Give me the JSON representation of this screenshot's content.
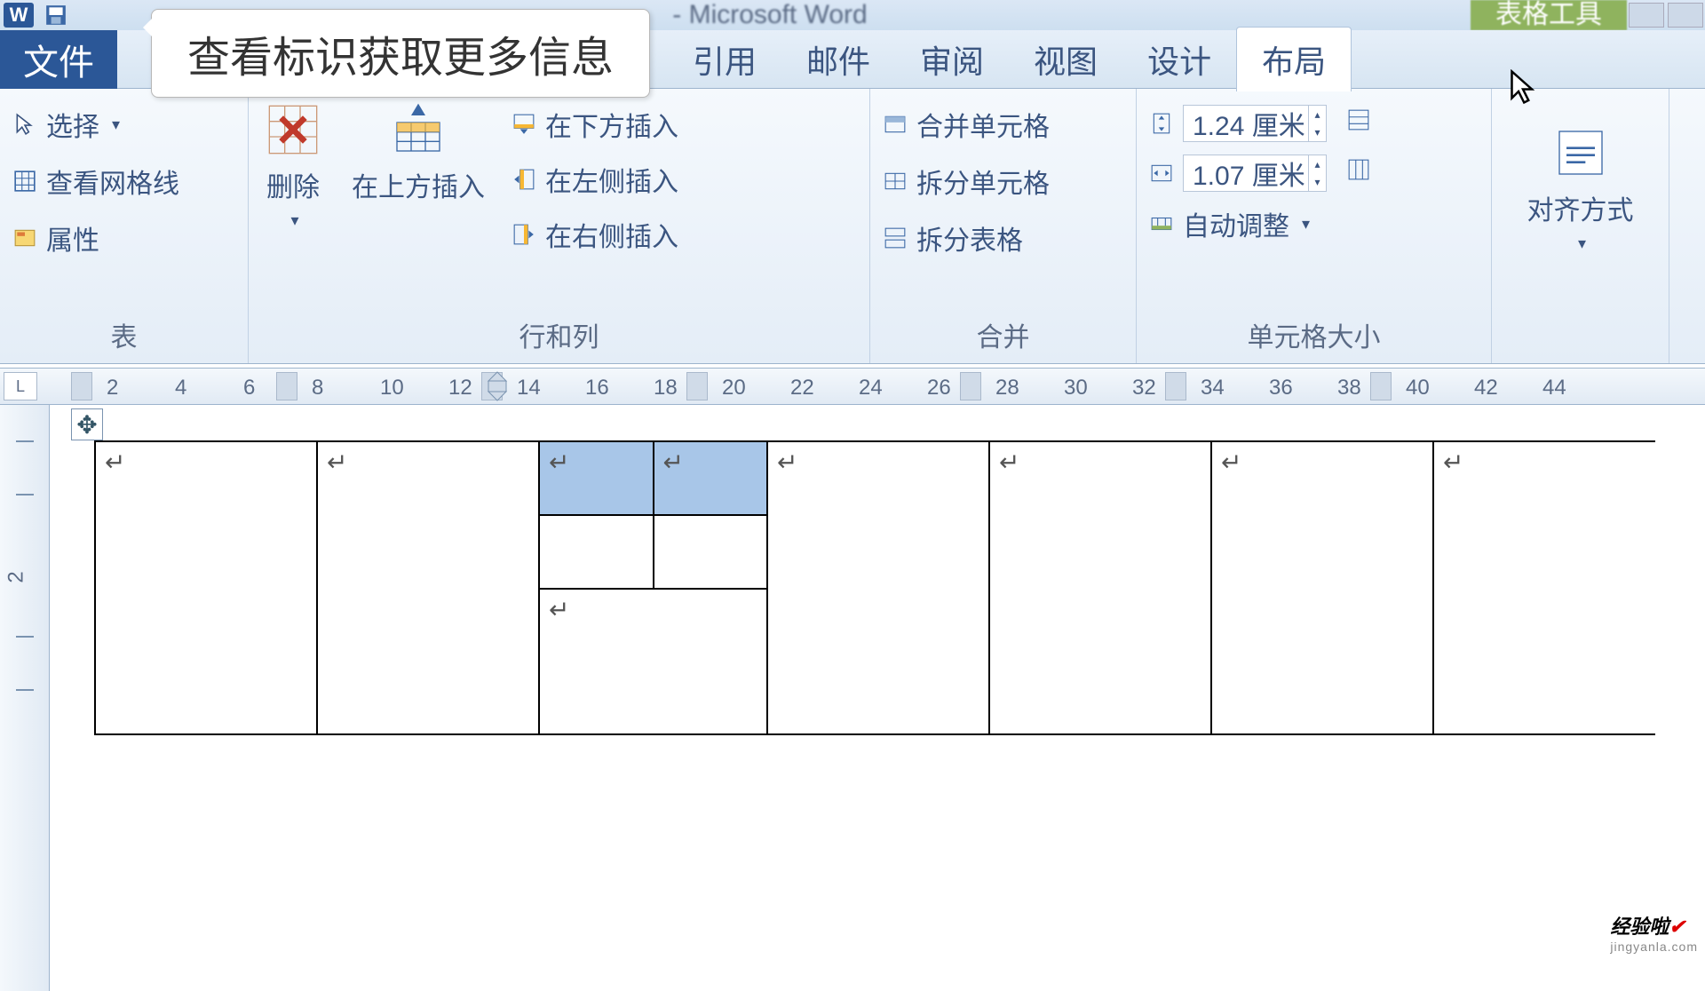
{
  "title": {
    "app_title": "- Microsoft Word",
    "contextual": "表格工具",
    "tooltip": "查看标识获取更多信息"
  },
  "tabs": {
    "file": "文件",
    "references": "引用",
    "mailings": "邮件",
    "review": "审阅",
    "view": "视图",
    "design": "设计",
    "layout": "布局"
  },
  "ribbon": {
    "table": {
      "select": "选择",
      "gridlines": "查看网格线",
      "properties": "属性",
      "group": "表"
    },
    "rowscols": {
      "delete": "删除",
      "insert_above": "在上方插入",
      "insert_below": "在下方插入",
      "insert_left": "在左侧插入",
      "insert_right": "在右侧插入",
      "group": "行和列"
    },
    "merge": {
      "merge_cells": "合并单元格",
      "split_cells": "拆分单元格",
      "split_table": "拆分表格",
      "group": "合并"
    },
    "cellsize": {
      "height": "1.24 厘米",
      "width": "1.07 厘米",
      "autofit": "自动调整",
      "group": "单元格大小"
    },
    "alignment": {
      "label": "对齐方式"
    }
  },
  "ruler": {
    "ticks": [
      "2",
      "4",
      "6",
      "8",
      "10",
      "12",
      "14",
      "16",
      "18",
      "20",
      "22",
      "24",
      "26",
      "28",
      "30",
      "32",
      "34",
      "36",
      "38",
      "40",
      "42",
      "44"
    ]
  },
  "ruler_v": {
    "tick": "2"
  },
  "mark": "↵",
  "watermark": {
    "text": "经验啦",
    "sub": "jingyanla.com"
  }
}
